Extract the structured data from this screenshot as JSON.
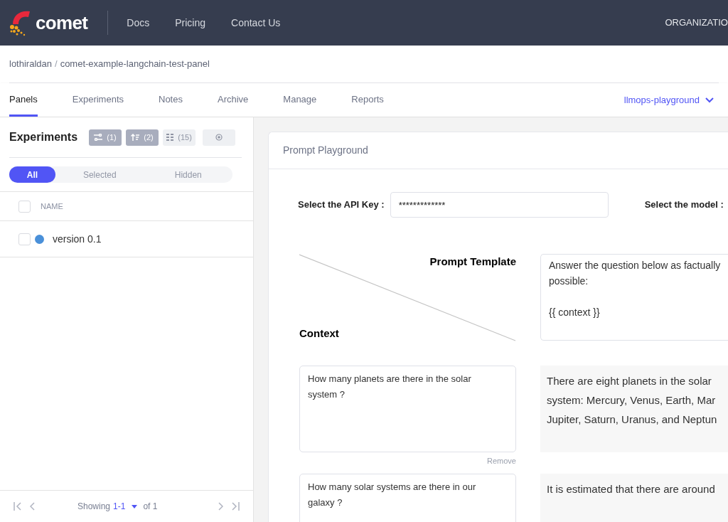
{
  "brand": "comet",
  "nav": [
    "Docs",
    "Pricing",
    "Contact Us"
  ],
  "org": "ORGANIZATIO",
  "breadcrumb": {
    "owner": "lothiraldan",
    "separator": "/",
    "project": "comet-example-langchain-test-panel"
  },
  "tabs": [
    {
      "label": "Panels",
      "selected": true
    },
    {
      "label": "Experiments",
      "selected": false
    },
    {
      "label": "Notes",
      "selected": false
    },
    {
      "label": "Archive",
      "selected": false
    },
    {
      "label": "Manage",
      "selected": false
    },
    {
      "label": "Reports",
      "selected": false
    }
  ],
  "workspace": "llmops-playground",
  "sidebar": {
    "title": "Experiments",
    "tools": [
      {
        "kind": "filter",
        "count": "(1)",
        "active": true
      },
      {
        "kind": "sort",
        "count": "(2)",
        "active": true
      },
      {
        "kind": "group",
        "count": "(15)",
        "active": false
      },
      {
        "kind": "settings",
        "active": false
      }
    ],
    "filters": [
      {
        "label": "All",
        "selected": true
      },
      {
        "label": "Selected",
        "selected": false
      },
      {
        "label": "Hidden",
        "selected": false
      }
    ],
    "column": "NAME",
    "all_checked": false,
    "rows": [
      {
        "name": "version 0.1",
        "checked": false,
        "color": "#4a90d9"
      }
    ],
    "pager": {
      "showing": "Showing",
      "range": "1-1",
      "of": "of 1"
    }
  },
  "panel": {
    "title": "Prompt Playground",
    "api_key_label": "Select the API Key :",
    "api_key": "*************",
    "model_label": "Select the model :",
    "template_label": "Prompt Template",
    "context_label": "Context",
    "template_paragraphs": [
      [
        "Answer the question below as factually",
        "possible:"
      ],
      [
        "{{ context }}"
      ]
    ],
    "rows": [
      {
        "question": "How many planets are there in the solar system ?",
        "remove": "Remove",
        "answer_lines": [
          "There are eight planets in the solar",
          "system: Mercury, Venus, Earth, Mar",
          "Jupiter, Saturn, Uranus, and Neptun"
        ]
      },
      {
        "question": "How many solar systems are there in our galaxy ?",
        "answer_lines": [
          "It is estimated that there are around"
        ]
      }
    ]
  }
}
